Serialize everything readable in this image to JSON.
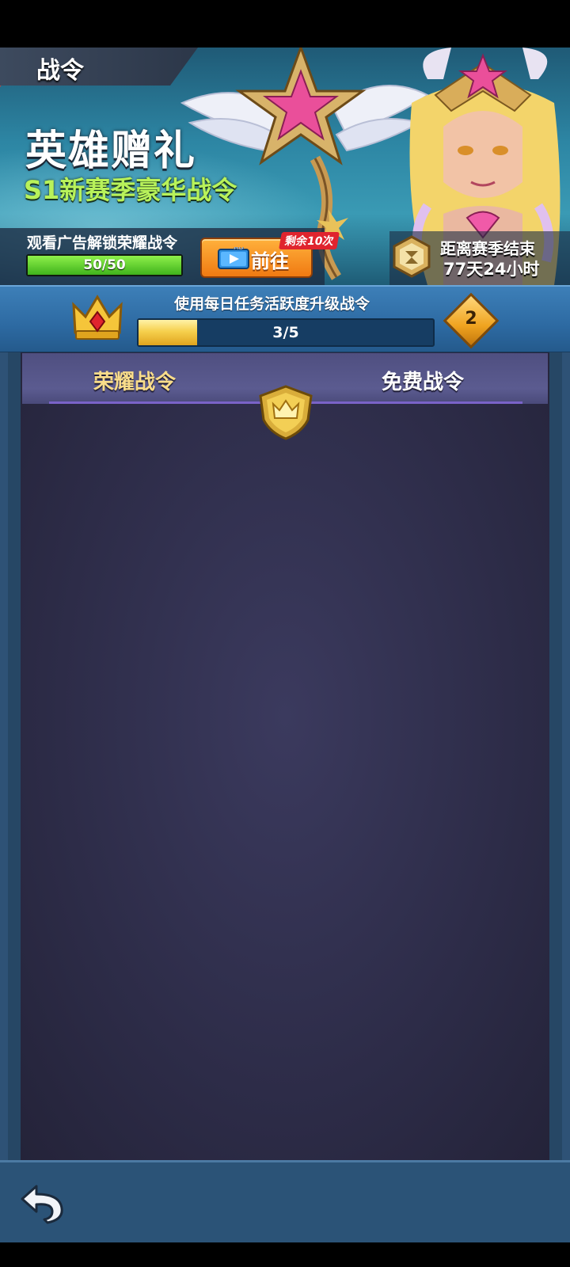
{
  "page_title": "战令",
  "banner": {
    "headline": "英雄赠礼",
    "subtitle": "S1新赛季豪华战令",
    "ad_unlock": {
      "label": "观看广告解锁荣耀战令",
      "progress_text": "50/50",
      "progress_fraction": 1.0,
      "button_badge": "AD",
      "button_label": "前往",
      "remaining_badge": "剩余10次"
    },
    "season": {
      "label": "距离赛季结束",
      "time_left": "77天24小时"
    }
  },
  "level": {
    "task_label": "使用每日任务活跃度升级战令",
    "progress_text": "3/5",
    "progress_fraction": 0.2,
    "current_level": "2"
  },
  "tabs": {
    "glory": "荣耀战令",
    "free": "免费战令"
  },
  "icons": {
    "crown": "crown-icon",
    "emblem": "shield-crown-icon",
    "back": "back-arrow-icon",
    "season": "timer-icon",
    "ad_video": "video-ad-icon"
  },
  "colors": {
    "subtitle_green": "#b8f25a",
    "glory_tab_gold": "#f8dc8a",
    "button_orange": "#f07a12",
    "progress_green": "#3fb31c"
  }
}
